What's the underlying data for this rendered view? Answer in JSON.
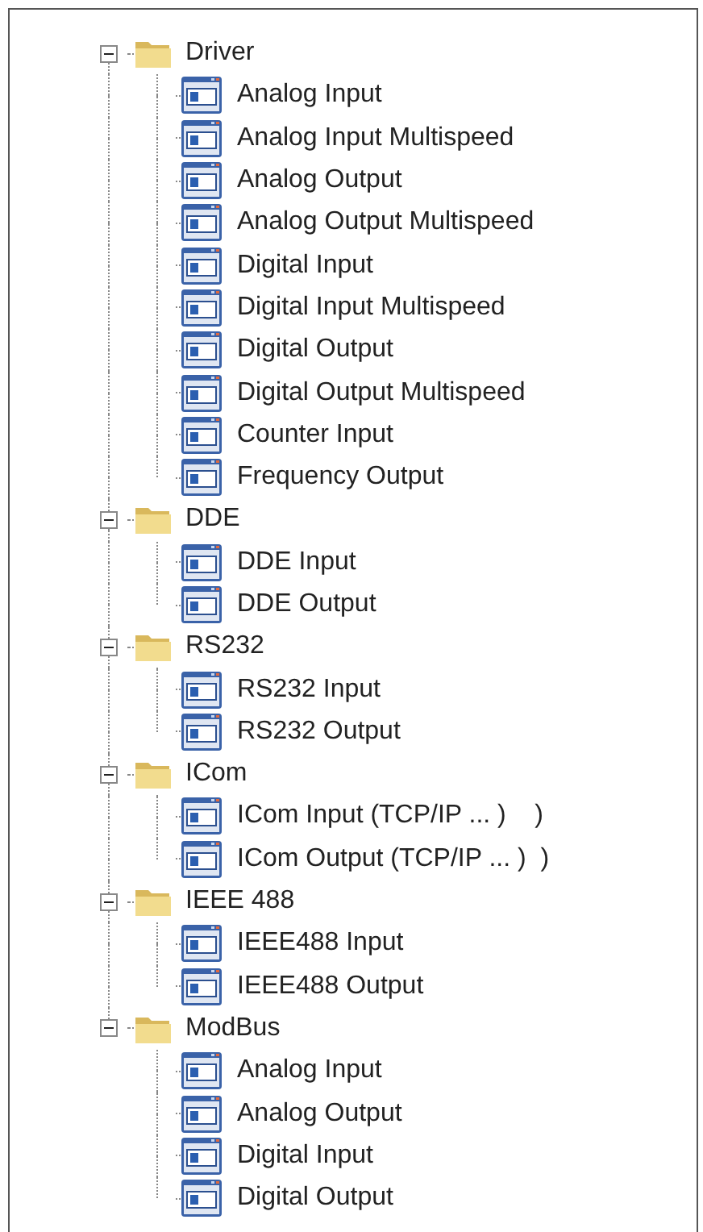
{
  "tree": [
    {
      "label": "Driver",
      "expanded": true,
      "children": [
        {
          "label": "Analog Input"
        },
        {
          "label": "Analog Input Multispeed"
        },
        {
          "label": "Analog Output"
        },
        {
          "label": "Analog Output Multispeed"
        },
        {
          "label": "Digital Input"
        },
        {
          "label": "Digital Input Multispeed"
        },
        {
          "label": "Digital Output"
        },
        {
          "label": "Digital Output Multispeed"
        },
        {
          "label": "Counter Input"
        },
        {
          "label": "Frequency Output"
        }
      ]
    },
    {
      "label": "DDE",
      "expanded": true,
      "children": [
        {
          "label": "DDE Input"
        },
        {
          "label": "DDE Output"
        }
      ]
    },
    {
      "label": "RS232",
      "expanded": true,
      "children": [
        {
          "label": "RS232 Input"
        },
        {
          "label": "RS232 Output"
        }
      ]
    },
    {
      "label": "ICom",
      "expanded": true,
      "children": [
        {
          "label": "ICom Input (TCP/IP ... )    )"
        },
        {
          "label": "ICom Output (TCP/IP ... )  )"
        }
      ]
    },
    {
      "label": "IEEE 488",
      "expanded": true,
      "children": [
        {
          "label": "IEEE488 Input"
        },
        {
          "label": "IEEE488 Output"
        }
      ]
    },
    {
      "label": "ModBus",
      "expanded": true,
      "children": [
        {
          "label": "Analog Input"
        },
        {
          "label": "Analog Output"
        },
        {
          "label": "Digital Input"
        },
        {
          "label": "Digital Output"
        }
      ]
    }
  ]
}
